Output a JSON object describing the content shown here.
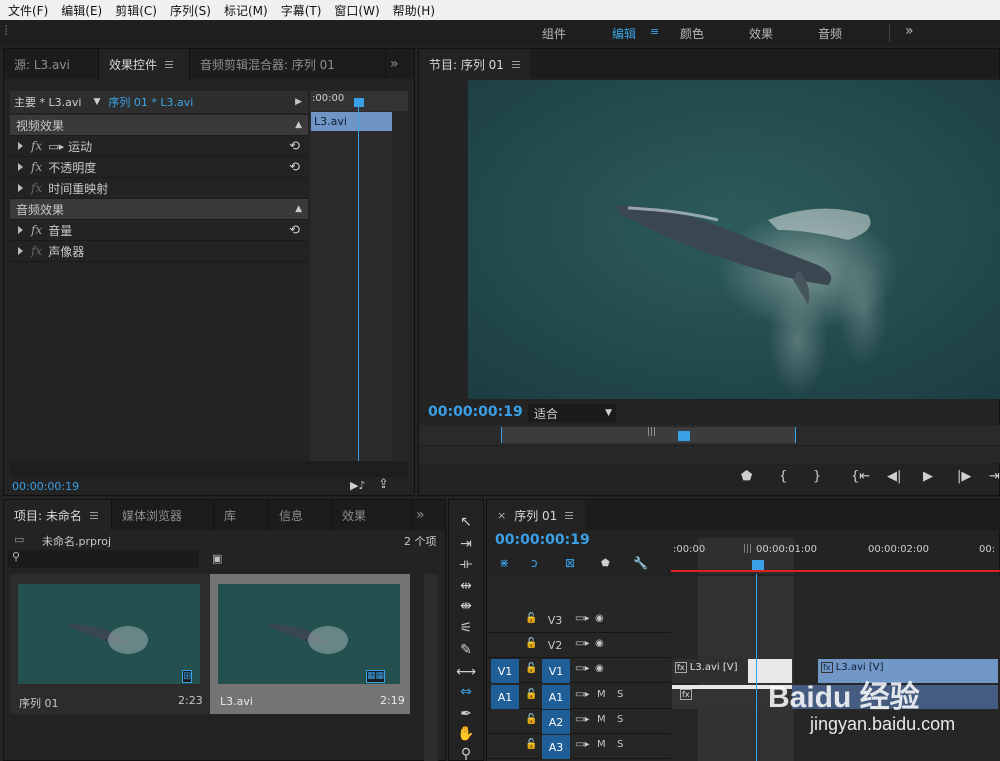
{
  "menu": [
    "文件(F)",
    "编辑(E)",
    "剪辑(C)",
    "序列(S)",
    "标记(M)",
    "字幕(T)",
    "窗口(W)",
    "帮助(H)"
  ],
  "workspaces": {
    "assembly": "组件",
    "editing": "编辑",
    "color": "颜色",
    "effects": "效果",
    "audio": "音频",
    "overflow": "»"
  },
  "source_panel": {
    "tabs": [
      "源: L3.avi",
      "效果控件",
      "音频剪辑混合器: 序列 01"
    ],
    "overflow": "»",
    "header_master": "主要 * L3.avi",
    "header_sequence": "序列 01 * L3.avi",
    "mini_timecode": ":00:00",
    "clip_label": "L3.avi",
    "video_effects": "视频效果",
    "motion": "运动",
    "opacity": "不透明度",
    "time_remap": "时间重映射",
    "audio_effects": "音频效果",
    "volume": "音量",
    "panner": "声像器",
    "fx": "fx",
    "reset_icon": "⟲",
    "timecode": "00:00:00:19"
  },
  "program_monitor": {
    "title": "节目: 序列 01",
    "timecode": "00:00:00:19",
    "fit": "适合"
  },
  "project_panel": {
    "tabs": [
      "项目: 未命名",
      "媒体浏览器",
      "库",
      "信息",
      "效果"
    ],
    "overflow": "»",
    "project_file": "未命名.prproj",
    "item_count": "2 个项",
    "items": [
      {
        "name": "序列 01",
        "duration": "2:23"
      },
      {
        "name": "L3.avi",
        "duration": "2:19"
      }
    ]
  },
  "timeline": {
    "title": "序列 01",
    "close": "×",
    "timecode": "00:00:00:19",
    "ruler": [
      ":00:00",
      "00:00:01:00",
      "00:00:02:00",
      "00:"
    ],
    "video_tracks": [
      {
        "src": "",
        "name": "V3"
      },
      {
        "src": "",
        "name": "V2"
      },
      {
        "src": "V1",
        "name": "V1"
      }
    ],
    "audio_tracks": [
      {
        "src": "A1",
        "name": "A1"
      },
      {
        "src": "",
        "name": "A2"
      },
      {
        "src": "",
        "name": "A3"
      }
    ],
    "clip_v1a": "L3.avi [V]",
    "clip_v1b": "L3.avi [V]",
    "mute": "M",
    "solo": "S"
  },
  "watermark": {
    "brand": "Baidu 经验",
    "url": "jingyan.baidu.com"
  }
}
